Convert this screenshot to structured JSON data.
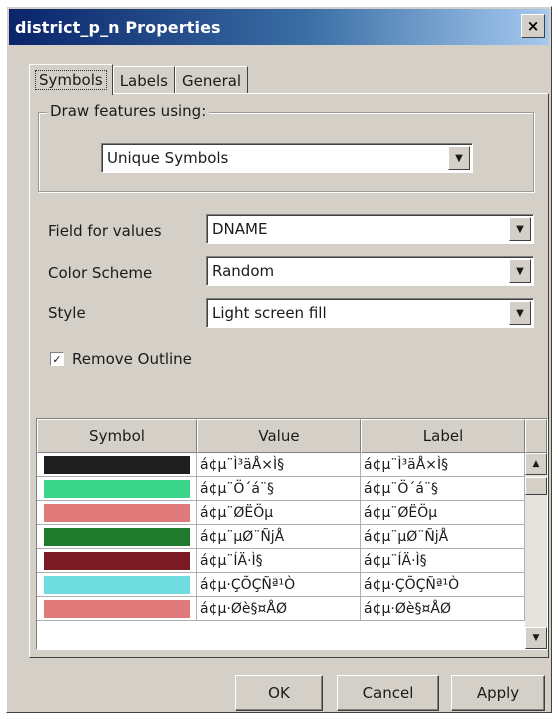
{
  "window": {
    "title": "district_p_n Properties",
    "close_label": "×"
  },
  "tabs": [
    {
      "label": "Symbols",
      "active": true
    },
    {
      "label": "Labels",
      "active": false
    },
    {
      "label": "General",
      "active": false
    }
  ],
  "draw_group": {
    "legend": "Draw features using:",
    "value": "Unique Symbols"
  },
  "fields": {
    "field_for_values": {
      "label": "Field for values",
      "value": "DNAME"
    },
    "color_scheme": {
      "label": "Color Scheme",
      "value": "Random"
    },
    "style": {
      "label": "Style",
      "value": "Light screen fill"
    }
  },
  "remove_outline": {
    "label": "Remove Outline",
    "checked": true,
    "check_glyph": "✓"
  },
  "grid": {
    "headers": [
      "Symbol",
      "Value",
      "Label"
    ],
    "rows": [
      {
        "color": "#1e1e1e",
        "value": "á¢µ¨Ì³äÅ×Ì§",
        "label": "á¢µ¨Ì³äÅ×Ì§"
      },
      {
        "color": "#3ad58a",
        "value": "á¢µ¨Ö´á¨§",
        "label": "á¢µ¨Ö´á¨§"
      },
      {
        "color": "#e07a7a",
        "value": "á¢µ¨ØËÖµ",
        "label": "á¢µ¨ØËÖµ"
      },
      {
        "color": "#1f7a2e",
        "value": "á¢µ¨µØ¨ÑjÅ",
        "label": "á¢µ¨µØ¨ÑjÅ"
      },
      {
        "color": "#7a1a22",
        "value": "á¢µ¨ÍÄ·Ì§",
        "label": "á¢µ¨ÍÄ·Ì§"
      },
      {
        "color": "#6fdde0",
        "value": "á¢µ·ÇÕÇÑª¹Ò",
        "label": "á¢µ·ÇÕÇÑª¹Ò"
      },
      {
        "color": "#e07a7a",
        "value": "á¢µ·Øè§¤ÅØ",
        "label": "á¢µ·Øè§¤ÅØ"
      }
    ]
  },
  "buttons": {
    "ok": "OK",
    "cancel": "Cancel",
    "apply": "Apply"
  },
  "colors": {
    "title_start": "#0a246a",
    "title_end": "#a6caf0",
    "face": "#d4d0c8"
  },
  "icons": {
    "combo_arrow": "▼",
    "scroll_up": "▲",
    "scroll_down": "▼"
  }
}
